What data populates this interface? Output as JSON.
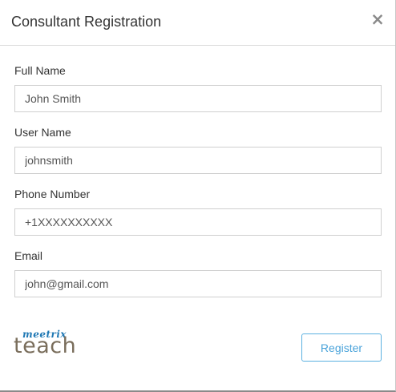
{
  "modal": {
    "title": "Consultant Registration",
    "close_label": "×"
  },
  "form": {
    "fields": [
      {
        "label": "Full Name",
        "value": "John Smith"
      },
      {
        "label": "User Name",
        "value": "johnsmith"
      },
      {
        "label": "Phone Number",
        "value": "+1XXXXXXXXXX"
      },
      {
        "label": "Email",
        "value": "john@gmail.com"
      }
    ]
  },
  "footer": {
    "logo_top": "meetrix",
    "logo_bottom": "teach",
    "register_label": "Register"
  },
  "colors": {
    "accent": "#4aa3da",
    "logo_blue": "#1f78b4",
    "logo_brown": "#7a6e5c"
  }
}
